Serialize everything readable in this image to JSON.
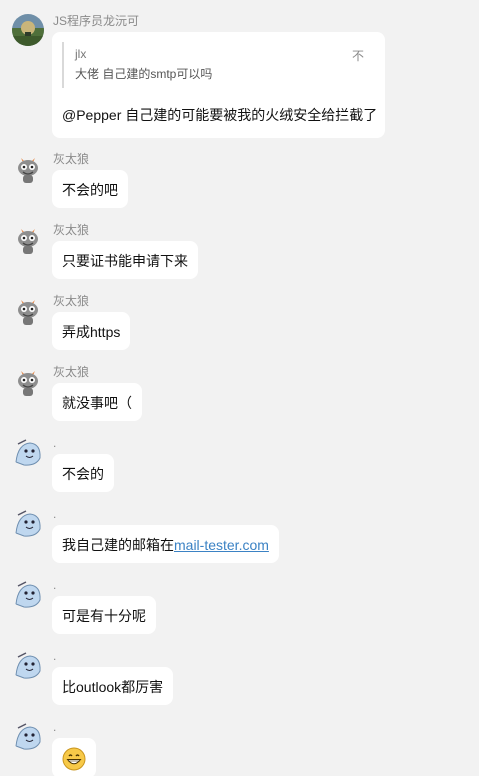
{
  "messages": [
    {
      "sender": "JS程序员龙沅可",
      "avatar_icon": "landscape-photo-avatar",
      "quote": {
        "user": "jlx",
        "text": "大佬 自己建的smtp可以吗",
        "action": "不"
      },
      "text": "@Pepper 自己建的可能要被我的火绒安全给拦截了"
    },
    {
      "sender": "灰太狼",
      "avatar_icon": "grey-wolf-avatar",
      "text": "不会的吧"
    },
    {
      "sender": "灰太狼",
      "avatar_icon": "grey-wolf-avatar",
      "text": "只要证书能申请下来"
    },
    {
      "sender": "灰太狼",
      "avatar_icon": "grey-wolf-avatar",
      "text": "弄成https"
    },
    {
      "sender": "灰太狼",
      "avatar_icon": "grey-wolf-avatar",
      "text": "就没事吧（"
    },
    {
      "sender": ".",
      "avatar_icon": "cartoon-seal-avatar",
      "text": "不会的"
    },
    {
      "sender": ".",
      "avatar_icon": "cartoon-seal-avatar",
      "text_prefix": "我自己建的邮箱在",
      "link": "mail-tester.com"
    },
    {
      "sender": ".",
      "avatar_icon": "cartoon-seal-avatar",
      "text": "可是有十分呢"
    },
    {
      "sender": ".",
      "avatar_icon": "cartoon-seal-avatar",
      "text": "比outlook都厉害"
    },
    {
      "sender": ".",
      "avatar_icon": "cartoon-seal-avatar",
      "emoji": "grinning-face-emoji"
    }
  ],
  "colors": {
    "background": "#f2f2f2",
    "bubble": "#ffffff",
    "link": "#3b82c4",
    "sender_name": "#8a8a8a"
  }
}
